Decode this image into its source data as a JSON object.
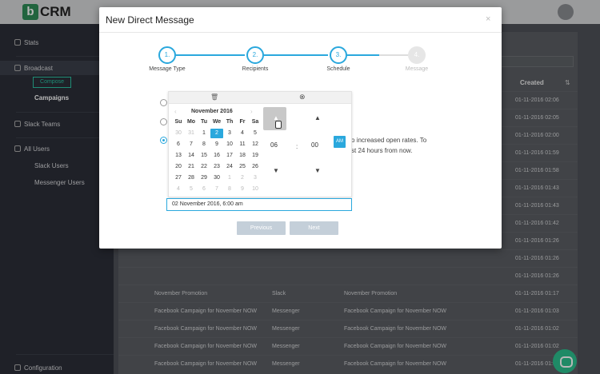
{
  "app": {
    "logo_letter": "b",
    "logo_text": "CRM"
  },
  "sidebar": {
    "items": [
      {
        "label": "Stats",
        "icon": "bar-chart-icon"
      },
      {
        "label": "Broadcast",
        "icon": "broadcast-icon"
      },
      {
        "label": "Slack Teams",
        "icon": "slack-icon"
      },
      {
        "label": "All Users",
        "icon": "users-icon"
      },
      {
        "label": "Configuration",
        "icon": "gear-icon"
      }
    ],
    "compose_label": "Compose",
    "campaigns_label": "Campaigns",
    "slack_users_label": "Slack Users",
    "messenger_users_label": "Messenger Users"
  },
  "table": {
    "created_header": "Created",
    "sort_icon": "sort-icon",
    "created_dates": [
      "01-11-2016 02:06",
      "01-11-2016 02:05",
      "01-11-2016 02:00",
      "01-11-2016 01:59",
      "01-11-2016 01:58",
      "01-11-2016 01:43",
      "01-11-2016 01:43",
      "01-11-2016 01:42",
      "01-11-2016 01:26",
      "01-11-2016 01:26",
      "01-11-2016 01:26",
      "01-11-2016 01:17",
      "01-11-2016 01:03",
      "01-11-2016 01:02",
      "01-11-2016 01:02",
      "01-11-2016 01:02",
      "01-11-2016 01:02",
      "01-11-2016 01:02"
    ],
    "visible_rows": [
      {
        "name": "November Promotion",
        "channel": "Slack",
        "message": "November Promotion",
        "created": "01-11-2016 01:17"
      },
      {
        "name": "Facebook Campaign for November NOW",
        "channel": "Messenger",
        "message": "Facebook Campaign for November NOW",
        "created": "01-11-2016 01:03"
      },
      {
        "name": "Facebook Campaign for November NOW",
        "channel": "Messenger",
        "message": "Facebook Campaign for November NOW",
        "created": "01-11-2016 01:02"
      },
      {
        "name": "Facebook Campaign for November NOW",
        "channel": "Messenger",
        "message": "Facebook Campaign for November NOW",
        "created": "01-11-2016 01:02"
      },
      {
        "name": "Facebook Campaign for November NOW",
        "channel": "Messenger",
        "message": "Facebook Campaign for November NOW",
        "created": "01-11-2016 01:02"
      },
      {
        "name": "Facebook Campaign for November NOW",
        "channel": "Messenger",
        "message": "Facebook Campaign for November NOW",
        "created": "01-11-2016 01:02"
      },
      {
        "name": "Facebook Campaign for November NOW",
        "channel": "Messenger",
        "message": "Facebook Campaign for November NOW",
        "created": "01-11-2016 01:02"
      }
    ]
  },
  "modal": {
    "title": "New Direct Message",
    "close": "×",
    "steps": [
      {
        "num": "1.",
        "label": "Message Type"
      },
      {
        "num": "2.",
        "label": "Recipients"
      },
      {
        "num": "3.",
        "label": "Schedule"
      },
      {
        "num": "4.",
        "label": "Message"
      }
    ],
    "bg_text_1": "o increased open rates. To",
    "bg_text_2": "st 24 hours from now.",
    "picker": {
      "month_title": "November 2016",
      "prev": "‹",
      "next": "›",
      "trash_icon": "trash-icon",
      "clock_icon": "clock-icon",
      "dow": [
        "Su",
        "Mo",
        "Tu",
        "We",
        "Th",
        "Fr",
        "Sa"
      ],
      "weeks": [
        [
          "30",
          "31",
          "1",
          "2",
          "3",
          "4",
          "5"
        ],
        [
          "6",
          "7",
          "8",
          "9",
          "10",
          "11",
          "12"
        ],
        [
          "13",
          "14",
          "15",
          "16",
          "17",
          "18",
          "19"
        ],
        [
          "20",
          "21",
          "22",
          "23",
          "24",
          "25",
          "26"
        ],
        [
          "27",
          "28",
          "29",
          "30",
          "1",
          "2",
          "3"
        ],
        [
          "4",
          "5",
          "6",
          "7",
          "8",
          "9",
          "10"
        ]
      ],
      "hour": "06",
      "minute": "00",
      "colon": ":",
      "ampm": "AM",
      "up_arrow": "▲",
      "down_arrow": "▼"
    },
    "datetime_value": "02 November 2016, 6:00 am",
    "previous_label": "Previous",
    "next_label": "Next"
  }
}
